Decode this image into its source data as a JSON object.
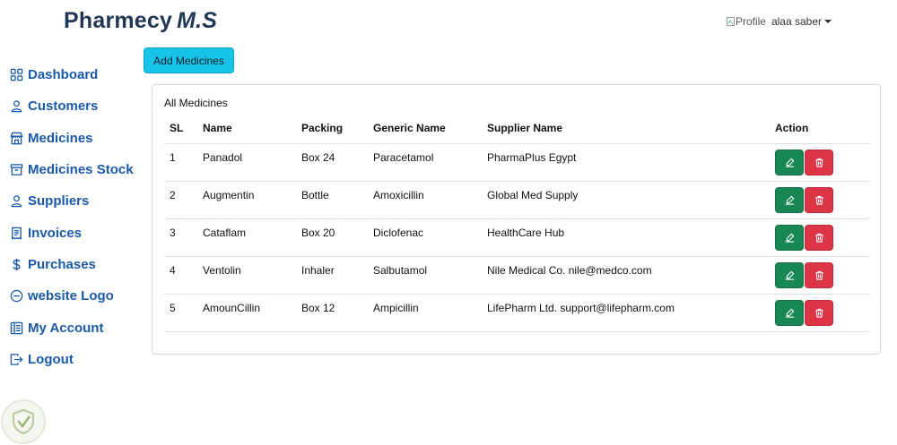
{
  "brand": {
    "name": "Pharmecy",
    "suffix": "M.S"
  },
  "profile": {
    "img_alt": "Profile",
    "username": "alaa saber"
  },
  "sidebar": {
    "items": [
      {
        "label": "Dashboard",
        "icon": "grid-icon"
      },
      {
        "label": "Customers",
        "icon": "person-icon"
      },
      {
        "label": "Medicines",
        "icon": "store-icon"
      },
      {
        "label": "Medicines Stock",
        "icon": "archive-icon"
      },
      {
        "label": "Suppliers",
        "icon": "person-icon"
      },
      {
        "label": "Invoices",
        "icon": "receipt-icon"
      },
      {
        "label": "Purchases",
        "icon": "dollar-icon"
      },
      {
        "label": "website Logo",
        "icon": "dash-circle-icon"
      },
      {
        "label": "My Account",
        "icon": "layout-icon"
      },
      {
        "label": "Logout",
        "icon": "logout-icon"
      }
    ]
  },
  "toolbar": {
    "add_label": "Add Medicines"
  },
  "card": {
    "title": "All Medicines",
    "headers": {
      "sl": "SL",
      "name": "Name",
      "packing": "Packing",
      "generic": "Generic Name",
      "supplier": "Supplier Name",
      "action": "Action"
    },
    "rows": [
      {
        "sl": "1",
        "name": "Panadol",
        "packing": "Box 24",
        "generic": "Paracetamol",
        "supplier": "PharmaPlus Egypt"
      },
      {
        "sl": "2",
        "name": "Augmentin",
        "packing": "Bottle",
        "generic": "Amoxicillin",
        "supplier": "Global Med Supply"
      },
      {
        "sl": "3",
        "name": "Cataflam",
        "packing": "Box 20",
        "generic": "Diclofenac",
        "supplier": "HealthCare Hub"
      },
      {
        "sl": "4",
        "name": "Ventolin",
        "packing": "Inhaler",
        "generic": "Salbutamol",
        "supplier": "Nile Medical Co. nile@medco.com"
      },
      {
        "sl": "5",
        "name": "AmounCillin",
        "packing": "Box 12",
        "generic": "Ampicillin",
        "supplier": "LifePharm Ltd. support@lifepharm.com"
      }
    ]
  },
  "colors": {
    "accent": "#17c4e8",
    "nav": "#1a5aa8",
    "brand": "#1f3655",
    "edit": "#198754",
    "delete": "#dc3545"
  }
}
